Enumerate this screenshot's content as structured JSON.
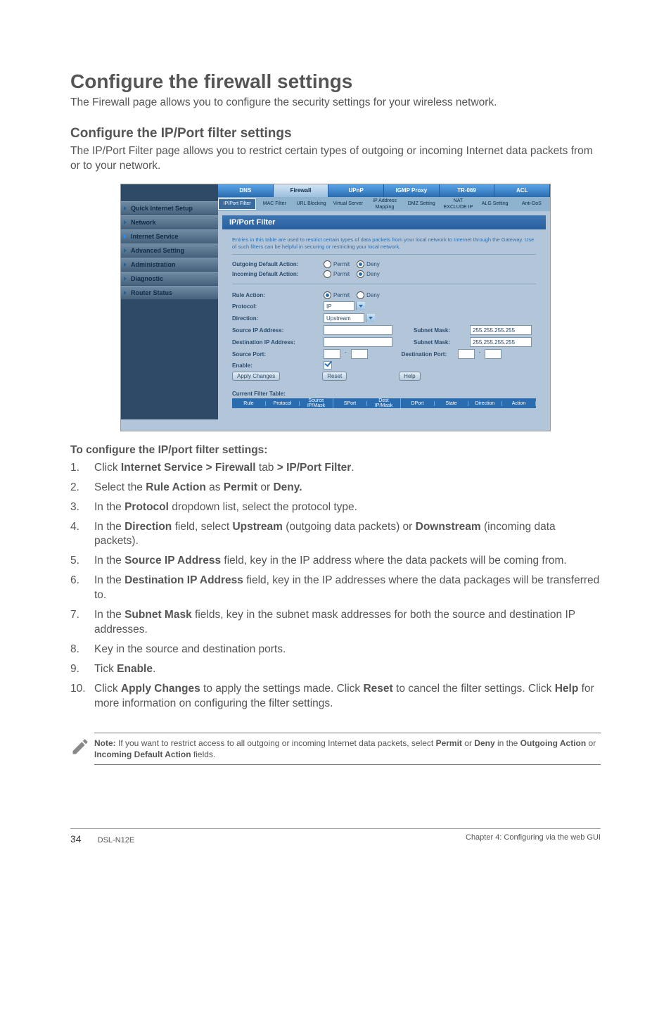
{
  "heading": "Configure the firewall settings",
  "intro": "The Firewall page allows you to configure the security settings for your wireless network.",
  "subheading": "Configure the IP/Port filter settings",
  "subintro": "The IP/Port Filter page allows you to restrict certain types of outgoing or incoming Internet data packets from or to your network.",
  "sidebar": {
    "items": [
      "Quick Internet Setup",
      "Network",
      "Internet Service",
      "Advanced Setting",
      "Administration",
      "Diagnostic",
      "Router Status"
    ],
    "active_index": 2
  },
  "tabs": [
    "DNS",
    "Firewall",
    "UPnP",
    "IGMP Proxy",
    "TR-069",
    "ACL"
  ],
  "tab_active_index": 1,
  "subtabs": [
    "IP/Port Filter",
    "MAC Filter",
    "URL Blocking",
    "Virtual Server",
    "IP Address Mapping",
    "DMZ Setting",
    "NAT EXCLUDE IP",
    "ALG Setting",
    "Anti-DoS"
  ],
  "subtab_active_index": 0,
  "panel": {
    "title": "IP/Port Filter",
    "info": "Entries in this table are used to restrict certain types of data packets from your local network to Internet through the Gateway. Use of such filters can be helpful in securing or restricting your local network.",
    "outgoing_label": "Outgoing Default Action:",
    "incoming_label": "Incoming Default Action:",
    "permit": "Permit",
    "deny": "Deny",
    "rule_action_label": "Rule Action:",
    "protocol_label": "Protocol:",
    "protocol_value": "IP",
    "direction_label": "Direction:",
    "direction_value": "Upstream",
    "src_ip_label": "Source IP Address:",
    "dst_ip_label": "Destination IP Address:",
    "src_port_label": "Source Port:",
    "enable_label": "Enable:",
    "subnet_mask_label": "Subnet Mask:",
    "subnet_mask_value": "255.255.255.255",
    "dest_port_label": "Destination Port:",
    "dash": "-",
    "apply_btn": "Apply Changes",
    "reset_btn": "Reset",
    "help_btn": "Help",
    "table_title": "Current Filter Table:",
    "table_cols": [
      "Rule",
      "Protocol",
      "Source IP/Mask",
      "SPort",
      "Dest IP/Mask",
      "DPort",
      "State",
      "Direction",
      "Action"
    ]
  },
  "instructions_head": "To configure the IP/port filter settings:",
  "steps": {
    "s1a": "Click ",
    "s1b": "Internet Service > Firewall",
    "s1c": " tab ",
    "s1d": "> IP/Port Filter",
    "s1e": ".",
    "s2a": "Select the ",
    "s2b": "Rule Action",
    "s2c": " as ",
    "s2d": "Permit",
    "s2e": " or ",
    "s2f": "Deny.",
    "s3a": "In the ",
    "s3b": "Protocol",
    "s3c": " dropdown list, select the protocol type.",
    "s4a": "In the ",
    "s4b": "Direction",
    "s4c": " field, select ",
    "s4d": "Upstream",
    "s4e": " (outgoing data packets) or ",
    "s4f": "Downstream",
    "s4g": " (incoming data packets).",
    "s5a": "In the ",
    "s5b": "Source IP Address",
    "s5c": " field, key in the IP address where the data packets will be coming from.",
    "s6a": "In the ",
    "s6b": "Destination IP Address",
    "s6c": " field, key in the IP addresses where the data packages will be transferred to.",
    "s7a": "In the ",
    "s7b": "Subnet Mask",
    "s7c": " fields, key in the subnet mask addresses for both the source and destination IP addresses.",
    "s8": "Key in the source and destination ports.",
    "s9a": "Tick ",
    "s9b": "Enable",
    "s9c": ".",
    "s10a": "Click ",
    "s10b": "Apply Changes",
    "s10c": " to apply the settings made. Click ",
    "s10d": "Reset",
    "s10e": " to cancel the filter settings. Click ",
    "s10f": "Help",
    "s10g": " for more information on configuring the filter settings."
  },
  "note_label": "Note:",
  "note_a": " If you want to restrict access to all outgoing or incoming Internet data packets, select ",
  "note_permit": "Permit",
  "note_or": " or ",
  "note_deny": "Deny",
  "note_in": " in the ",
  "note_out_act": "Outgoing Action",
  "note_or2": " or ",
  "note_in_act": "Incoming Default Action",
  "note_fields": " fields.",
  "footer_page": "34",
  "footer_model": "DSL-N12E",
  "footer_chapter": "Chapter 4: Configuring via the web GUI"
}
